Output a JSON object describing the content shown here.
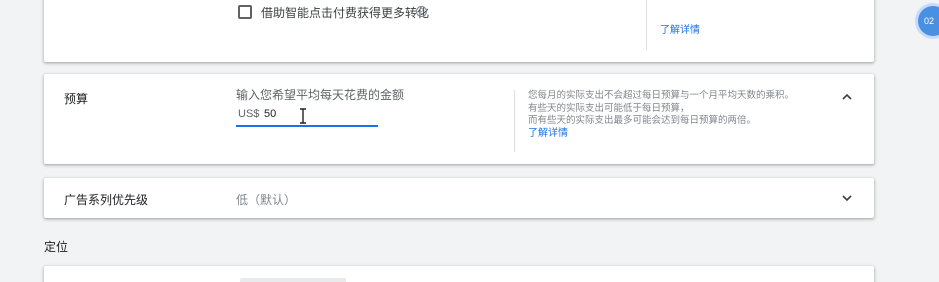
{
  "top_card": {
    "checkbox_label": "借助智能点击付费获得更多转化",
    "help_icon": "help-icon",
    "cut_text": "· · · · · · · · · · · · · ·",
    "learn_more": "了解详情"
  },
  "budget": {
    "label": "预算",
    "prompt": "输入您希望平均每天花费的金额",
    "currency_prefix": "US$",
    "value": "50",
    "help_lines": [
      "您每月的实际支出不会超过每日预算与一个月平均天数的乘积。",
      "有些天的实际支出可能低于每日预算，",
      "而有些天的实际支出最多可能会达到每日预算的两倍。"
    ],
    "learn_more": "了解详情",
    "collapse_icon": "chevron-up-icon"
  },
  "priority": {
    "label": "广告系列优先级",
    "value": "低（默认）",
    "expand_icon": "chevron-down-icon"
  },
  "targeting": {
    "heading": "定位"
  },
  "side_badge": {
    "text": "02"
  },
  "colors": {
    "accent": "#1a73e8",
    "background": "#f1f3f4",
    "badge": "#4a90e2"
  }
}
